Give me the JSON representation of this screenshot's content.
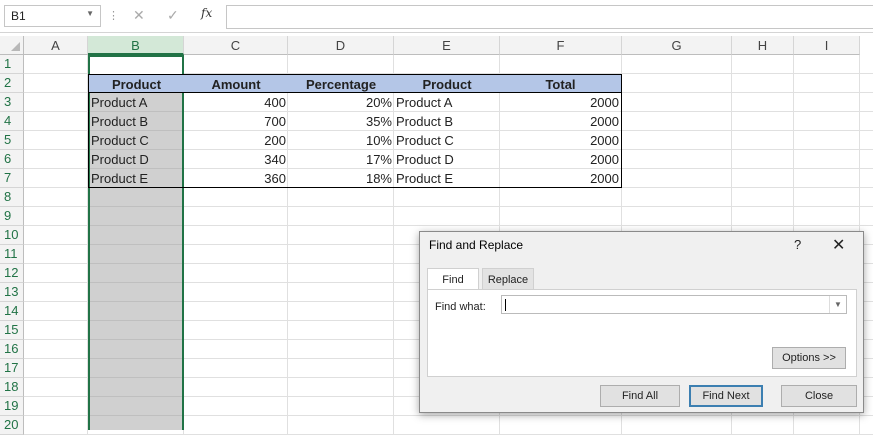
{
  "formula_bar": {
    "name_box": "B1",
    "cancel_icon": "close-icon",
    "enter_icon": "check-icon",
    "fx_label": "fx",
    "formula": ""
  },
  "columns": [
    "A",
    "B",
    "C",
    "D",
    "E",
    "F",
    "G",
    "H",
    "I"
  ],
  "rows": [
    "1",
    "2",
    "3",
    "4",
    "5",
    "6",
    "7",
    "8",
    "9",
    "10",
    "11",
    "12",
    "13",
    "14",
    "15",
    "16",
    "17",
    "18",
    "19",
    "20"
  ],
  "table": {
    "headers": [
      "Product",
      "Amount",
      "Percentage",
      "Product",
      "Total"
    ],
    "rows": [
      [
        "Product A",
        "400",
        "20%",
        "Product A",
        "2000"
      ],
      [
        "Product B",
        "700",
        "35%",
        "Product B",
        "2000"
      ],
      [
        "Product C",
        "200",
        "10%",
        "Product C",
        "2000"
      ],
      [
        "Product D",
        "340",
        "17%",
        "Product D",
        "2000"
      ],
      [
        "Product E",
        "360",
        "18%",
        "Product E",
        "2000"
      ]
    ]
  },
  "dialog": {
    "title": "Find and Replace",
    "help": "?",
    "close": "✕",
    "tabs": [
      "Find",
      "Replace"
    ],
    "find_what_label": "Find what:",
    "find_what_value": "",
    "options_button": "Options >>",
    "find_all_button": "Find All",
    "find_next_button": "Find Next",
    "close_button": "Close"
  }
}
